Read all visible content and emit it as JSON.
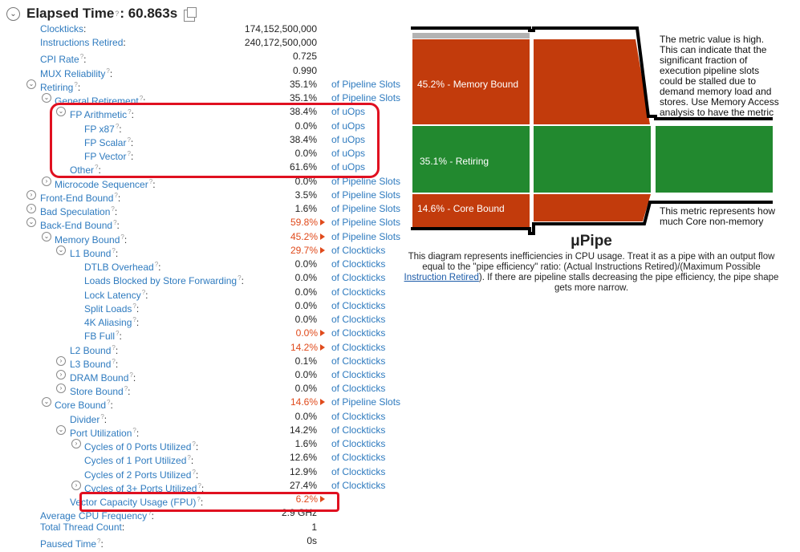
{
  "header": {
    "title": "Elapsed Time",
    "help_mark": "?",
    "value": ": 60.863s"
  },
  "metrics": [
    {
      "label": "Clockticks",
      "value": "174,152,500,000",
      "unit": "",
      "indent": 0,
      "expand": "",
      "red": false,
      "flag": false,
      "help": false
    },
    {
      "label": "Instructions Retired",
      "value": "240,172,500,000",
      "unit": "",
      "indent": 0,
      "expand": "",
      "red": false,
      "flag": false,
      "help": false
    },
    {
      "label": "CPI Rate",
      "value": "0.725",
      "unit": "",
      "indent": 0,
      "expand": "",
      "red": false,
      "flag": false,
      "help": true
    },
    {
      "label": "MUX Reliability",
      "value": "0.990",
      "unit": "",
      "indent": 0,
      "expand": "",
      "red": false,
      "flag": false,
      "help": true
    },
    {
      "label": "Retiring",
      "value": "35.1%",
      "unit": "of Pipeline Slots",
      "indent": 0,
      "expand": "collapse",
      "red": false,
      "flag": false,
      "help": true
    },
    {
      "label": "General Retirement",
      "value": "35.1%",
      "unit": "of Pipeline Slots",
      "indent": 1,
      "expand": "collapse",
      "red": false,
      "flag": false,
      "help": true
    },
    {
      "label": "FP Arithmetic",
      "value": "38.4%",
      "unit": "of uOps",
      "indent": 2,
      "expand": "collapse",
      "red": false,
      "flag": false,
      "help": true
    },
    {
      "label": "FP x87",
      "value": "0.0%",
      "unit": "of uOps",
      "indent": 3,
      "expand": "",
      "red": false,
      "flag": false,
      "help": true
    },
    {
      "label": "FP Scalar",
      "value": "38.4%",
      "unit": "of uOps",
      "indent": 3,
      "expand": "",
      "red": false,
      "flag": false,
      "help": true
    },
    {
      "label": "FP Vector",
      "value": "0.0%",
      "unit": "of uOps",
      "indent": 3,
      "expand": "",
      "red": false,
      "flag": false,
      "help": true
    },
    {
      "label": "Other",
      "value": "61.6%",
      "unit": "of uOps",
      "indent": 2,
      "expand": "",
      "red": false,
      "flag": false,
      "help": true
    },
    {
      "label": "Microcode Sequencer",
      "value": "0.0%",
      "unit": "of Pipeline Slots",
      "indent": 1,
      "expand": "expand",
      "red": false,
      "flag": false,
      "help": true
    },
    {
      "label": "Front-End Bound",
      "value": "3.5%",
      "unit": "of Pipeline Slots",
      "indent": 0,
      "expand": "expand",
      "red": false,
      "flag": false,
      "help": true
    },
    {
      "label": "Bad Speculation",
      "value": "1.6%",
      "unit": "of Pipeline Slots",
      "indent": 0,
      "expand": "expand",
      "red": false,
      "flag": false,
      "help": true
    },
    {
      "label": "Back-End Bound",
      "value": "59.8%",
      "unit": "of Pipeline Slots",
      "indent": 0,
      "expand": "collapse",
      "red": true,
      "flag": true,
      "help": true
    },
    {
      "label": "Memory Bound",
      "value": "45.2%",
      "unit": "of Pipeline Slots",
      "indent": 1,
      "expand": "collapse",
      "red": true,
      "flag": true,
      "help": true
    },
    {
      "label": "L1 Bound",
      "value": "29.7%",
      "unit": "of Clockticks",
      "indent": 2,
      "expand": "collapse",
      "red": true,
      "flag": true,
      "help": true
    },
    {
      "label": "DTLB Overhead",
      "value": "0.0%",
      "unit": "of Clockticks",
      "indent": 3,
      "expand": "",
      "red": false,
      "flag": false,
      "help": true
    },
    {
      "label": "Loads Blocked by Store Forwarding",
      "value": "0.0%",
      "unit": "of Clockticks",
      "indent": 3,
      "expand": "",
      "red": false,
      "flag": false,
      "help": true
    },
    {
      "label": "Lock Latency",
      "value": "0.0%",
      "unit": "of Clockticks",
      "indent": 3,
      "expand": "",
      "red": false,
      "flag": false,
      "help": true
    },
    {
      "label": "Split Loads",
      "value": "0.0%",
      "unit": "of Clockticks",
      "indent": 3,
      "expand": "",
      "red": false,
      "flag": false,
      "help": true
    },
    {
      "label": "4K Aliasing",
      "value": "0.0%",
      "unit": "of Clockticks",
      "indent": 3,
      "expand": "",
      "red": false,
      "flag": false,
      "help": true
    },
    {
      "label": "FB Full",
      "value": "0.0%",
      "unit": "of Clockticks",
      "indent": 3,
      "expand": "",
      "red": true,
      "flag": true,
      "help": true
    },
    {
      "label": "L2 Bound",
      "value": "14.2%",
      "unit": "of Clockticks",
      "indent": 2,
      "expand": "",
      "red": true,
      "flag": true,
      "help": true
    },
    {
      "label": "L3 Bound",
      "value": "0.1%",
      "unit": "of Clockticks",
      "indent": 2,
      "expand": "expand",
      "red": false,
      "flag": false,
      "help": true
    },
    {
      "label": "DRAM Bound",
      "value": "0.0%",
      "unit": "of Clockticks",
      "indent": 2,
      "expand": "expand",
      "red": false,
      "flag": false,
      "help": true
    },
    {
      "label": "Store Bound",
      "value": "0.0%",
      "unit": "of Clockticks",
      "indent": 2,
      "expand": "expand",
      "red": false,
      "flag": false,
      "help": true
    },
    {
      "label": "Core Bound",
      "value": "14.6%",
      "unit": "of Pipeline Slots",
      "indent": 1,
      "expand": "collapse",
      "red": true,
      "flag": true,
      "help": true
    },
    {
      "label": "Divider",
      "value": "0.0%",
      "unit": "of Clockticks",
      "indent": 2,
      "expand": "",
      "red": false,
      "flag": false,
      "help": true
    },
    {
      "label": "Port Utilization",
      "value": "14.2%",
      "unit": "of Clockticks",
      "indent": 2,
      "expand": "collapse",
      "red": false,
      "flag": false,
      "help": true
    },
    {
      "label": "Cycles of 0 Ports Utilized",
      "value": "1.6%",
      "unit": "of Clockticks",
      "indent": 3,
      "expand": "expand",
      "red": false,
      "flag": false,
      "help": true
    },
    {
      "label": "Cycles of 1 Port Utilized",
      "value": "12.6%",
      "unit": "of Clockticks",
      "indent": 3,
      "expand": "",
      "red": false,
      "flag": false,
      "help": true
    },
    {
      "label": "Cycles of 2 Ports Utilized",
      "value": "12.9%",
      "unit": "of Clockticks",
      "indent": 3,
      "expand": "",
      "red": false,
      "flag": false,
      "help": true
    },
    {
      "label": "Cycles of 3+ Ports Utilized",
      "value": "27.4%",
      "unit": "of Clockticks",
      "indent": 3,
      "expand": "expand",
      "red": false,
      "flag": false,
      "help": true
    },
    {
      "label": "Vector Capacity Usage (FPU)",
      "value": "6.2%",
      "unit": "",
      "indent": 2,
      "expand": "",
      "red": true,
      "flag": true,
      "help": true
    },
    {
      "label": "Average CPU Frequency",
      "value": "2.9 GHz",
      "unit": "",
      "indent": 0,
      "expand": "",
      "red": false,
      "flag": false,
      "help": true
    },
    {
      "label": "Total Thread Count",
      "value": "1",
      "unit": "",
      "indent": 0,
      "expand": "",
      "red": false,
      "flag": false,
      "help": false
    },
    {
      "label": "Paused Time",
      "value": "0s",
      "unit": "",
      "indent": 0,
      "expand": "",
      "red": false,
      "flag": false,
      "help": true
    }
  ],
  "pipe": {
    "memory_bound": {
      "label": "45.2% - Memory Bound",
      "color": "#c23b0c"
    },
    "retiring": {
      "label": "35.1% - Retiring",
      "color": "#22892f"
    },
    "core_bound": {
      "label": "14.6% - Core Bound",
      "color": "#c23b0c"
    },
    "bad_speculation_color": "#b3b3b3",
    "text_high": "The metric value is high. This can indicate that the significant fraction of execution pipeline slots could be stalled due to demand memory load and stores. Use Memory Access analysis to have the metric",
    "text_core": "This metric represents how much Core non-memory",
    "title": "μPipe",
    "desc_before": "This diagram represents inefficiencies in CPU usage. Treat it as a pipe with an output flow equal to the \"pipe efficiency\" ratio: (Actual Instructions Retired)/(Maximum Possible ",
    "desc_link": "Instruction Retired",
    "desc_after": "). If there are pipeline stalls decreasing the pipe efficiency, the pipe shape gets more narrow."
  }
}
